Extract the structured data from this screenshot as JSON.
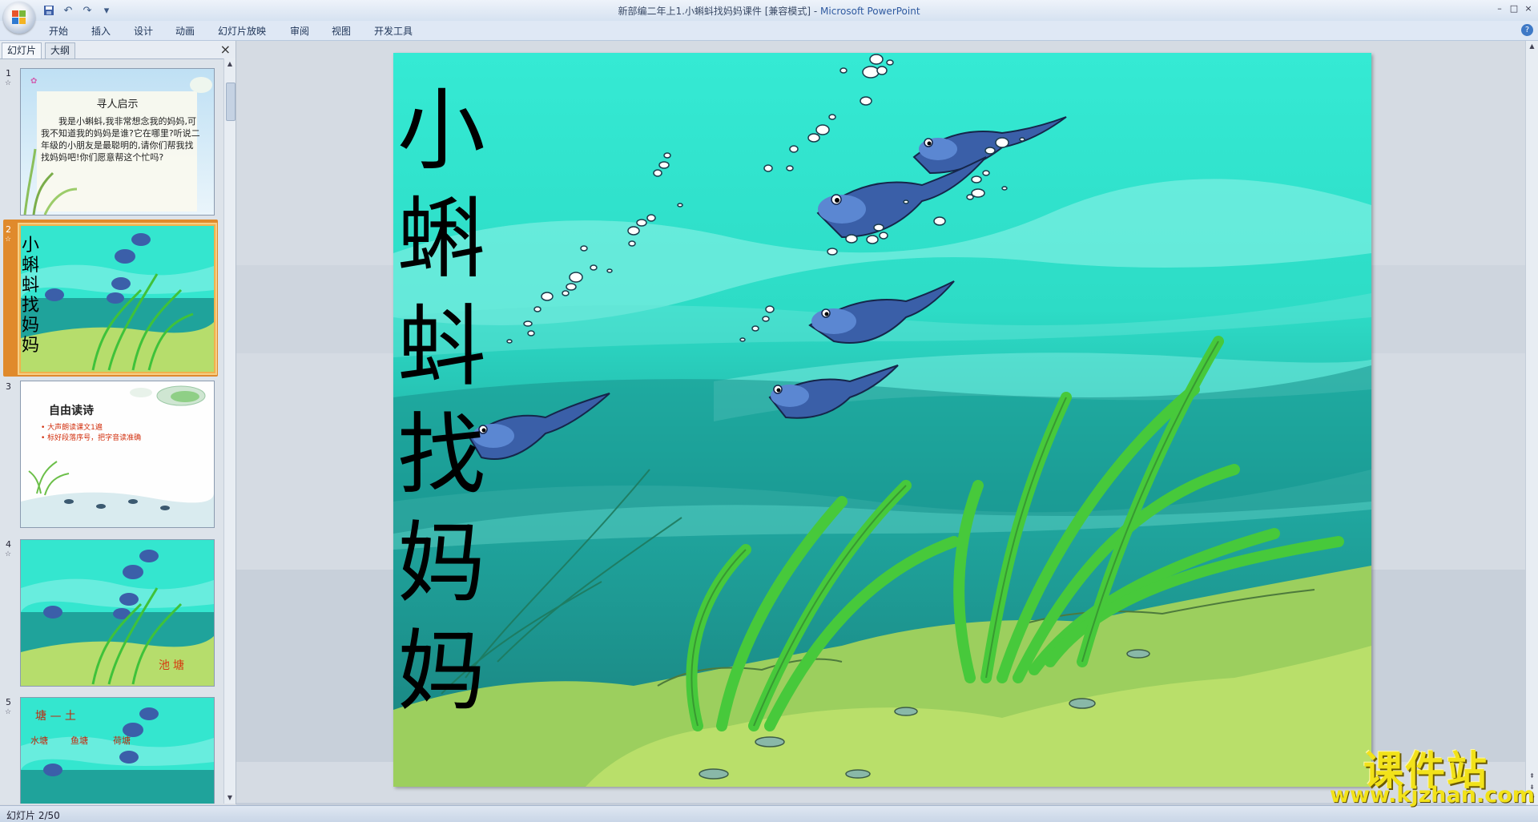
{
  "window": {
    "title": "新部编二年上1.小蝌蚪找妈妈课件 [兼容模式]",
    "separator": " - ",
    "app_name": "Microsoft PowerPoint",
    "controls": [
      "–",
      "□",
      "×"
    ]
  },
  "qat": {
    "save_icon": "save-icon",
    "undo_icon": "undo-icon",
    "redo_icon": "redo-icon",
    "more": "▾"
  },
  "ribbon": {
    "tabs": [
      "开始",
      "插入",
      "设计",
      "动画",
      "幻灯片放映",
      "审阅",
      "视图",
      "开发工具"
    ],
    "help": "?"
  },
  "left_panel": {
    "tabs": [
      "幻灯片",
      "大纲"
    ],
    "close": "×",
    "slides": [
      {
        "num": "1",
        "title": "寻人启示",
        "body": "我是小蝌蚪,我非常想念我的妈妈,可我不知道我的妈妈是谁?它在哪里?听说二年级的小朋友是最聪明的,请你们帮我找找妈妈吧!你们愿意帮这个忙吗?"
      },
      {
        "num": "2",
        "title": "小蝌蚪找妈妈"
      },
      {
        "num": "3",
        "title": "自由读诗",
        "bullets": [
          "• 大声朗读课文1遍",
          "• 标好段落序号，把字音读准确"
        ]
      },
      {
        "num": "4",
        "label": "池塘"
      },
      {
        "num": "5",
        "title": "塘 — 土",
        "words": [
          "水塘",
          "鱼塘",
          "荷塘"
        ]
      }
    ]
  },
  "slide": {
    "title_chars": [
      "小",
      "蝌",
      "蚪",
      "找",
      "妈",
      "妈"
    ],
    "colors": {
      "water_top": "#32e8d2",
      "water_mid": "#1fa8a0",
      "floor": "#b9df6a",
      "tadpole": "#3a5fa8",
      "weed": "#3fc23a"
    }
  },
  "status": {
    "text": "幻灯片 2/50"
  },
  "watermark": {
    "name": "课件站",
    "url": "www.kjzhan.com"
  }
}
